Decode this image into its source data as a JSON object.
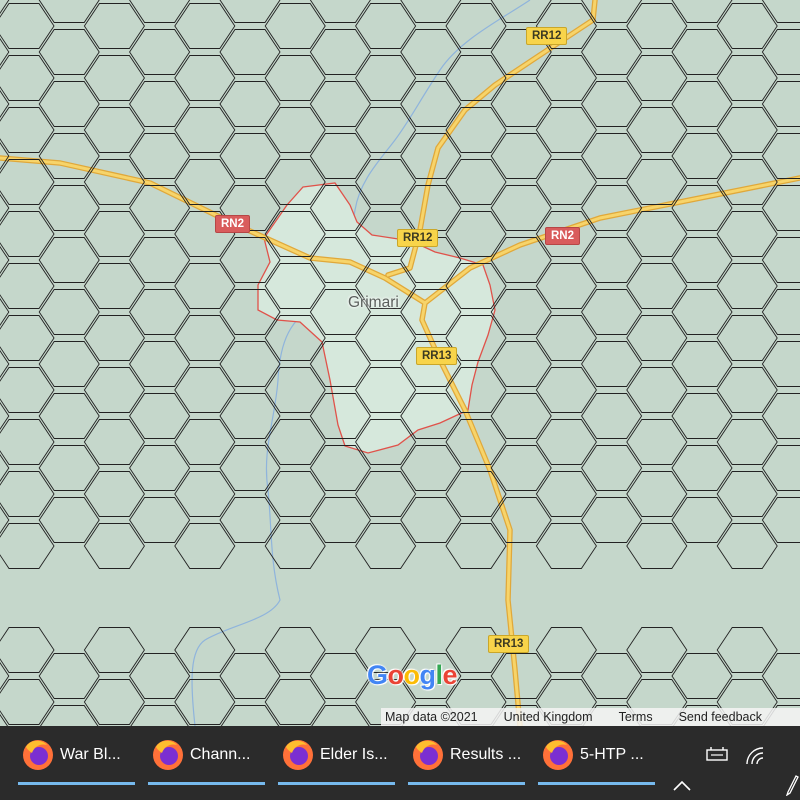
{
  "map": {
    "town_label": "Grimari",
    "road_labels": {
      "rr12_top": "RR12",
      "rr12_center": "RR12",
      "rn2_left": "RN2",
      "rn2_right": "RN2",
      "rr13_center": "RR13",
      "rr13_bottom": "RR13"
    },
    "colors": {
      "background": "#c5d7cb",
      "hex_grid": "#222222",
      "town_fill": "#d6e8dc",
      "town_border": "#e0524a",
      "road": "#f2c04c",
      "river": "#8fb4dc"
    }
  },
  "attribution": {
    "logo": "Google",
    "map_data": "Map data ©2021",
    "region": "United Kingdom",
    "terms": "Terms",
    "feedback": "Send feedback"
  },
  "taskbar": {
    "items": [
      {
        "icon": "firefox-icon",
        "label": "War Bl..."
      },
      {
        "icon": "firefox-icon",
        "label": "Chann..."
      },
      {
        "icon": "firefox-icon",
        "label": "Elder Is..."
      },
      {
        "icon": "firefox-icon",
        "label": "Results ..."
      },
      {
        "icon": "firefox-icon",
        "label": "5-HTP ..."
      }
    ],
    "tray": [
      "network-adapter-icon",
      "wifi-icon",
      "show-hidden-icons-chevron",
      "pen-icon"
    ]
  }
}
